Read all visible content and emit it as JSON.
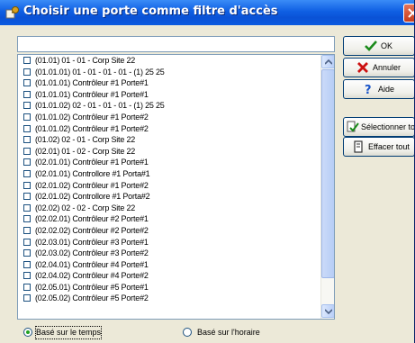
{
  "window": {
    "title": "Choisir une porte comme filtre d'accès",
    "icons": {
      "app": "door-key-icon",
      "close": "close-icon"
    }
  },
  "filter": {
    "value": "",
    "placeholder": ""
  },
  "list": {
    "items": [
      "(01.01) 01 - 01 - Corp Site 22",
      "(01.01.01) 01 - 01 - 01 - 01 - (1)  25 25",
      "(01.01.01) Contrôleur #1 Porte#1",
      "(01.01.01) Contrôleur #1 Porte#1",
      "(01.01.02) 02 - 01 - 01 - 01 - (1)  25 25",
      "(01.01.02) Contrôleur #1 Porte#2",
      "(01.01.02) Contrôleur #1 Porte#2",
      "(01.02) 02 - 01 - Corp Site 22",
      "(02.01) 01 - 02 - Corp Site 22",
      "(02.01.01) Contrôleur #1 Porte#1",
      "(02.01.01) Controllore #1 Porta#1",
      "(02.01.02) Contrôleur #1 Porte#2",
      "(02.01.02) Controllore #1 Porta#2",
      "(02.02) 02 - 02 - Corp Site 22",
      "(02.02.01) Contrôleur #2 Porte#1",
      "(02.02.02) Contrôleur #2 Porte#2",
      "(02.03.01) Contrôleur #3 Porte#1",
      "(02.03.02) Contrôleur #3 Porte#2",
      "(02.04.01) Contrôleur #4 Porte#1",
      "(02.04.02) Contrôleur #4 Porte#2",
      "(02.05.01) Contrôleur #5 Porte#1",
      "(02.05.02) Contrôleur #5 Porte#2"
    ],
    "scrollbar_icons": {
      "up": "scroll-up-arrow-icon",
      "down": "scroll-down-arrow-icon"
    }
  },
  "buttons": {
    "ok": {
      "label": "OK",
      "icon": "green-check-icon",
      "color": "#1a8a1a"
    },
    "cancel": {
      "label": "Annuler",
      "icon": "red-x-icon",
      "color": "#cc1111"
    },
    "help": {
      "label": "Aide",
      "icon": "question-mark-icon",
      "color": "#1a55c8"
    },
    "select_all": {
      "label": "Sélectionner tout",
      "icon": "select-all-icon"
    },
    "clear_all": {
      "label": "Effacer tout",
      "icon": "clear-all-icon"
    }
  },
  "filter_mode": {
    "options": [
      {
        "label": "Basé sur le temps",
        "selected": true
      },
      {
        "label": "Basé sur l'horaire",
        "selected": false
      }
    ]
  }
}
